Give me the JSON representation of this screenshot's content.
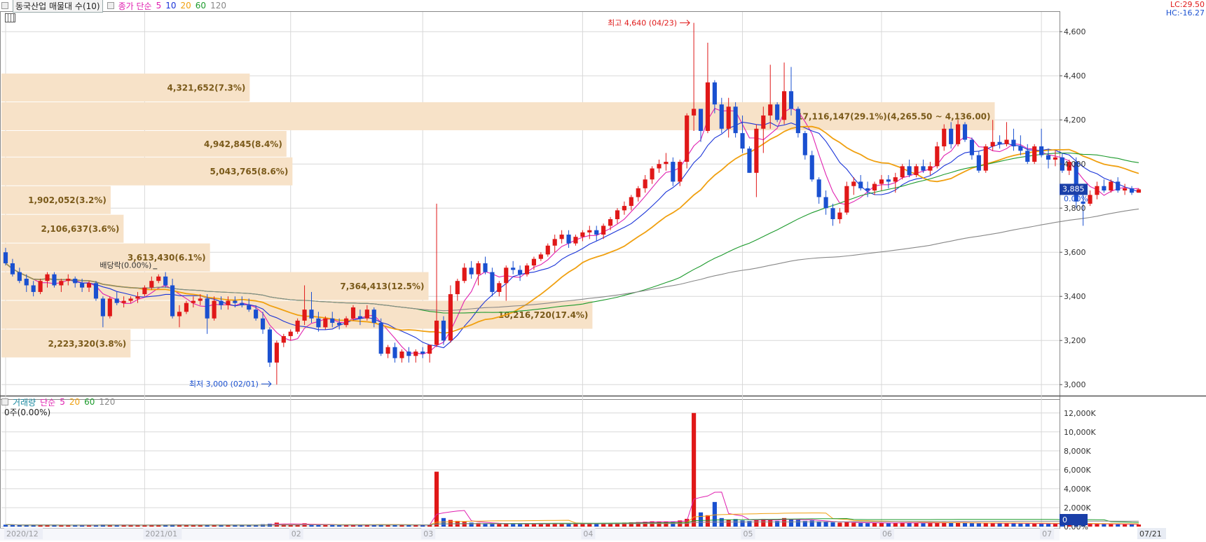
{
  "header": {
    "stock_name": "동국산업 매물대 수(10)",
    "ma_label": "종가 단순",
    "ma_periods": [
      "5",
      "10",
      "20",
      "60",
      "120"
    ],
    "ma_colors": [
      "#e020b0",
      "#1a34d8",
      "#f0a010",
      "#1c9a2c",
      "#888888"
    ]
  },
  "top_right": {
    "lc": "LC:29.50",
    "hc": "HC:-16.27"
  },
  "volume_header": {
    "label": "거래량",
    "ma_label": "단순",
    "ma_periods": [
      "5",
      "20",
      "60",
      "120"
    ],
    "readout": "0주(0.00%)"
  },
  "annotations": {
    "high": "최고 4,640 (04/23)",
    "low": "최저 3,000 (02/01)",
    "dividend": "배당락(0.00%)"
  },
  "price_tag": {
    "value": "3,885",
    "pct": "0.00%"
  },
  "volume_tag": {
    "value": "0",
    "pct": "0.00%"
  },
  "colors": {
    "up": "#e01818",
    "down": "#1a50d0",
    "profile": "#f7e2c8",
    "grid": "#d8d8d8"
  },
  "chart_data": {
    "type": "candlestick",
    "price_axis": {
      "range": [
        2950,
        4680
      ],
      "ticks": [
        "3,000",
        "3,200",
        "3,400",
        "3,600",
        "3,800",
        "4,000",
        "4,200",
        "4,400",
        "4,600"
      ]
    },
    "volume_axis": {
      "range": [
        0,
        12500
      ],
      "ticks": [
        "0.00%",
        "2,000K",
        "4,000K",
        "6,000K",
        "8,000K",
        "10,000K",
        "12,000K"
      ]
    },
    "x_labels": [
      {
        "label": "2020/12",
        "i": 0
      },
      {
        "label": "2021/01",
        "i": 20
      },
      {
        "label": "02",
        "i": 41
      },
      {
        "label": "03",
        "i": 60
      },
      {
        "label": "04",
        "i": 83
      },
      {
        "label": "05",
        "i": 106
      },
      {
        "label": "06",
        "i": 126
      },
      {
        "label": "07",
        "i": 149
      },
      {
        "label": "07/21",
        "i": 163
      }
    ],
    "volume_profile": [
      {
        "price_lo": 4150,
        "price_hi": 4280,
        "volume": "17,116,147(29.1%)(4,265.50 ~ 4,136.00)",
        "rel": 1.0
      },
      {
        "price_lo": 4280,
        "price_hi": 4410,
        "volume": "4,321,652(7.3%)",
        "rel": 0.25
      },
      {
        "price_lo": 4030,
        "price_hi": 4150,
        "volume": "4,942,845(8.4%)",
        "rel": 0.287
      },
      {
        "price_lo": 3900,
        "price_hi": 4030,
        "volume": "5,043,765(8.6%)",
        "rel": 0.293
      },
      {
        "price_lo": 3770,
        "price_hi": 3900,
        "volume": "1,902,052(3.2%)",
        "rel": 0.11
      },
      {
        "price_lo": 3640,
        "price_hi": 3770,
        "volume": "2,106,637(3.6%)",
        "rel": 0.123
      },
      {
        "price_lo": 3510,
        "price_hi": 3640,
        "volume": "3,613,430(6.1%)",
        "rel": 0.21
      },
      {
        "price_lo": 3380,
        "price_hi": 3510,
        "volume": "7,364,413(12.5%)",
        "rel": 0.43
      },
      {
        "price_lo": 3250,
        "price_hi": 3380,
        "volume": "10,216,720(17.4%)",
        "rel": 0.595
      },
      {
        "price_lo": 3120,
        "price_hi": 3250,
        "volume": "2,223,320(3.8%)",
        "rel": 0.13
      }
    ],
    "candles": [
      [
        3600,
        3620,
        3540,
        3550
      ],
      [
        3550,
        3570,
        3490,
        3500
      ],
      [
        3510,
        3530,
        3460,
        3470
      ],
      [
        3480,
        3500,
        3420,
        3450
      ],
      [
        3450,
        3470,
        3400,
        3420
      ],
      [
        3420,
        3480,
        3410,
        3470
      ],
      [
        3470,
        3510,
        3440,
        3500
      ],
      [
        3500,
        3510,
        3440,
        3450
      ],
      [
        3450,
        3480,
        3420,
        3470
      ],
      [
        3470,
        3500,
        3450,
        3480
      ],
      [
        3480,
        3490,
        3440,
        3460
      ],
      [
        3460,
        3480,
        3420,
        3440
      ],
      [
        3440,
        3470,
        3420,
        3460
      ],
      [
        3460,
        3470,
        3380,
        3390
      ],
      [
        3390,
        3400,
        3260,
        3310
      ],
      [
        3310,
        3400,
        3300,
        3390
      ],
      [
        3390,
        3420,
        3360,
        3370
      ],
      [
        3370,
        3400,
        3350,
        3380
      ],
      [
        3380,
        3400,
        3370,
        3390
      ],
      [
        3390,
        3420,
        3370,
        3400
      ],
      [
        3410,
        3450,
        3400,
        3440
      ],
      [
        3440,
        3490,
        3430,
        3470
      ],
      [
        3470,
        3500,
        3460,
        3490
      ],
      [
        3490,
        3510,
        3440,
        3450
      ],
      [
        3450,
        3480,
        3300,
        3310
      ],
      [
        3310,
        3360,
        3260,
        3330
      ],
      [
        3330,
        3380,
        3320,
        3370
      ],
      [
        3370,
        3400,
        3350,
        3380
      ],
      [
        3380,
        3410,
        3360,
        3390
      ],
      [
        3390,
        3410,
        3230,
        3300
      ],
      [
        3300,
        3400,
        3290,
        3380
      ],
      [
        3380,
        3400,
        3340,
        3360
      ],
      [
        3360,
        3400,
        3340,
        3380
      ],
      [
        3380,
        3400,
        3350,
        3370
      ],
      [
        3370,
        3400,
        3350,
        3360
      ],
      [
        3360,
        3390,
        3330,
        3340
      ],
      [
        3340,
        3360,
        3290,
        3300
      ],
      [
        3300,
        3330,
        3230,
        3250
      ],
      [
        3250,
        3260,
        3080,
        3100
      ],
      [
        3100,
        3200,
        3000,
        3190
      ],
      [
        3190,
        3230,
        3170,
        3220
      ],
      [
        3220,
        3250,
        3200,
        3240
      ],
      [
        3240,
        3300,
        3230,
        3290
      ],
      [
        3290,
        3450,
        3270,
        3340
      ],
      [
        3340,
        3420,
        3280,
        3300
      ],
      [
        3300,
        3330,
        3240,
        3260
      ],
      [
        3260,
        3310,
        3250,
        3300
      ],
      [
        3300,
        3330,
        3260,
        3280
      ],
      [
        3280,
        3300,
        3250,
        3270
      ],
      [
        3270,
        3310,
        3260,
        3300
      ],
      [
        3300,
        3360,
        3290,
        3350
      ],
      [
        3310,
        3340,
        3270,
        3300
      ],
      [
        3300,
        3360,
        3290,
        3340
      ],
      [
        3340,
        3350,
        3260,
        3280
      ],
      [
        3280,
        3300,
        3130,
        3140
      ],
      [
        3140,
        3180,
        3120,
        3170
      ],
      [
        3170,
        3190,
        3100,
        3120
      ],
      [
        3120,
        3160,
        3100,
        3150
      ],
      [
        3150,
        3170,
        3100,
        3130
      ],
      [
        3130,
        3160,
        3100,
        3150
      ],
      [
        3150,
        3170,
        3120,
        3140
      ],
      [
        3140,
        3180,
        3100,
        3180
      ],
      [
        3180,
        3820,
        3170,
        3290
      ],
      [
        3290,
        3310,
        3180,
        3200
      ],
      [
        3200,
        3450,
        3190,
        3410
      ],
      [
        3410,
        3480,
        3380,
        3470
      ],
      [
        3470,
        3550,
        3460,
        3530
      ],
      [
        3530,
        3560,
        3480,
        3500
      ],
      [
        3500,
        3560,
        3450,
        3550
      ],
      [
        3550,
        3580,
        3500,
        3510
      ],
      [
        3510,
        3530,
        3400,
        3420
      ],
      [
        3420,
        3470,
        3400,
        3460
      ],
      [
        3460,
        3540,
        3380,
        3530
      ],
      [
        3530,
        3560,
        3500,
        3520
      ],
      [
        3520,
        3540,
        3470,
        3500
      ],
      [
        3500,
        3550,
        3490,
        3540
      ],
      [
        3540,
        3580,
        3520,
        3570
      ],
      [
        3570,
        3600,
        3560,
        3590
      ],
      [
        3590,
        3640,
        3580,
        3630
      ],
      [
        3630,
        3680,
        3600,
        3660
      ],
      [
        3660,
        3700,
        3640,
        3680
      ],
      [
        3680,
        3700,
        3620,
        3640
      ],
      [
        3640,
        3680,
        3630,
        3670
      ],
      [
        3670,
        3700,
        3650,
        3690
      ],
      [
        3690,
        3720,
        3660,
        3700
      ],
      [
        3700,
        3720,
        3650,
        3680
      ],
      [
        3680,
        3730,
        3660,
        3720
      ],
      [
        3720,
        3760,
        3700,
        3750
      ],
      [
        3750,
        3800,
        3730,
        3790
      ],
      [
        3790,
        3830,
        3770,
        3810
      ],
      [
        3810,
        3860,
        3790,
        3850
      ],
      [
        3850,
        3900,
        3830,
        3890
      ],
      [
        3890,
        3950,
        3870,
        3930
      ],
      [
        3930,
        3990,
        3910,
        3980
      ],
      [
        3980,
        4020,
        3960,
        4000
      ],
      [
        4000,
        4050,
        3970,
        4010
      ],
      [
        4010,
        4030,
        3900,
        3920
      ],
      [
        3920,
        4020,
        3900,
        4010
      ],
      [
        4010,
        4230,
        3980,
        4220
      ],
      [
        4220,
        4640,
        4150,
        4250
      ],
      [
        4250,
        4250,
        4100,
        4150
      ],
      [
        4150,
        4550,
        4140,
        4370
      ],
      [
        4370,
        4380,
        4230,
        4270
      ],
      [
        4270,
        4300,
        4140,
        4160
      ],
      [
        4160,
        4300,
        4120,
        4260
      ],
      [
        4260,
        4280,
        4120,
        4140
      ],
      [
        4140,
        4220,
        4050,
        4070
      ],
      [
        4070,
        4080,
        3960,
        3960
      ],
      [
        3960,
        4180,
        3850,
        4160
      ],
      [
        4160,
        4260,
        4050,
        4220
      ],
      [
        4220,
        4450,
        4160,
        4270
      ],
      [
        4270,
        4280,
        4190,
        4200
      ],
      [
        4200,
        4460,
        4180,
        4330
      ],
      [
        4330,
        4440,
        4220,
        4250
      ],
      [
        4250,
        4260,
        4120,
        4140
      ],
      [
        4140,
        4150,
        4020,
        4040
      ],
      [
        4040,
        4060,
        3920,
        3930
      ],
      [
        3930,
        3940,
        3820,
        3850
      ],
      [
        3850,
        3880,
        3770,
        3800
      ],
      [
        3800,
        3820,
        3720,
        3750
      ],
      [
        3750,
        3800,
        3730,
        3780
      ],
      [
        3780,
        3920,
        3770,
        3900
      ],
      [
        3900,
        3940,
        3860,
        3920
      ],
      [
        3920,
        3950,
        3880,
        3890
      ],
      [
        3890,
        3920,
        3850,
        3880
      ],
      [
        3880,
        3920,
        3860,
        3910
      ],
      [
        3910,
        3950,
        3880,
        3930
      ],
      [
        3930,
        3950,
        3890,
        3920
      ],
      [
        3920,
        3960,
        3870,
        3940
      ],
      [
        3940,
        4000,
        3930,
        3990
      ],
      [
        3990,
        4020,
        3940,
        3950
      ],
      [
        3950,
        4000,
        3940,
        3990
      ],
      [
        3990,
        4020,
        3960,
        3970
      ],
      [
        3970,
        4010,
        3950,
        3990
      ],
      [
        3990,
        4100,
        3980,
        4080
      ],
      [
        4080,
        4180,
        4060,
        4160
      ],
      [
        4160,
        4190,
        4070,
        4090
      ],
      [
        4090,
        4200,
        4080,
        4180
      ],
      [
        4180,
        4190,
        4100,
        4110
      ],
      [
        4110,
        4120,
        4020,
        4040
      ],
      [
        4040,
        4060,
        3960,
        3970
      ],
      [
        3970,
        4090,
        3960,
        4080
      ],
      [
        4080,
        4200,
        4060,
        4100
      ],
      [
        4100,
        4130,
        4070,
        4090
      ],
      [
        4090,
        4190,
        4080,
        4110
      ],
      [
        4110,
        4160,
        4060,
        4080
      ],
      [
        4080,
        4130,
        4040,
        4060
      ],
      [
        4060,
        4090,
        4000,
        4010
      ],
      [
        4010,
        4090,
        4000,
        4080
      ],
      [
        4080,
        4160,
        4030,
        4040
      ],
      [
        4040,
        4070,
        3980,
        4020
      ],
      [
        4020,
        4060,
        3990,
        4030
      ],
      [
        4030,
        4050,
        3960,
        3970
      ],
      [
        3970,
        4020,
        3950,
        4010
      ],
      [
        4010,
        4030,
        3800,
        3830
      ],
      [
        3830,
        3860,
        3720,
        3820
      ],
      [
        3820,
        3880,
        3810,
        3860
      ],
      [
        3860,
        3920,
        3840,
        3900
      ],
      [
        3900,
        3930,
        3870,
        3880
      ],
      [
        3880,
        3930,
        3870,
        3920
      ],
      [
        3920,
        3940,
        3870,
        3880
      ],
      [
        3880,
        3910,
        3860,
        3890
      ],
      [
        3890,
        3900,
        3860,
        3870
      ],
      [
        3870,
        3890,
        3870,
        3885
      ]
    ],
    "volumes": [
      200,
      180,
      150,
      160,
      140,
      150,
      170,
      150,
      130,
      140,
      150,
      130,
      140,
      160,
      220,
      180,
      150,
      130,
      140,
      160,
      170,
      190,
      180,
      160,
      230,
      200,
      160,
      140,
      150,
      220,
      180,
      160,
      150,
      140,
      130,
      150,
      180,
      250,
      300,
      420,
      260,
      200,
      180,
      350,
      260,
      180,
      160,
      150,
      140,
      150,
      170,
      160,
      170,
      180,
      240,
      200,
      180,
      160,
      150,
      170,
      180,
      200,
      5800,
      900,
      700,
      600,
      500,
      420,
      380,
      350,
      300,
      280,
      320,
      300,
      260,
      280,
      300,
      280,
      320,
      360,
      340,
      300,
      280,
      300,
      320,
      300,
      330,
      360,
      400,
      420,
      450,
      480,
      520,
      560,
      540,
      500,
      480,
      650,
      820,
      12000,
      1500,
      1200,
      2600,
      900,
      700,
      800,
      650,
      600,
      700,
      800,
      750,
      600,
      900,
      800,
      700,
      600,
      650,
      550,
      500,
      450,
      420,
      480,
      400,
      380,
      360,
      380,
      400,
      360,
      380,
      420,
      400,
      380,
      360,
      380,
      420,
      460,
      400,
      440,
      380,
      360,
      340,
      360,
      380,
      340,
      360,
      340,
      320,
      300,
      320,
      310,
      300,
      290,
      280,
      300,
      320,
      300,
      280,
      290,
      270,
      260,
      250,
      240,
      230,
      220
    ]
  }
}
